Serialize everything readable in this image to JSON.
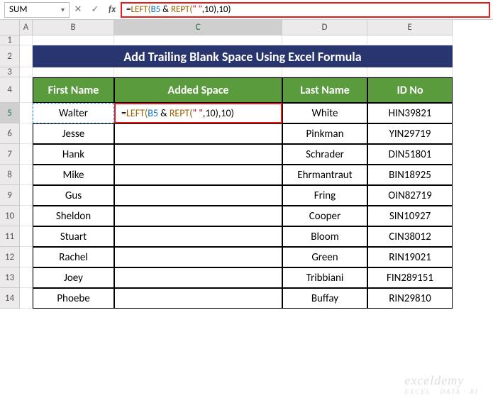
{
  "formula_bar": {
    "name_box": "SUM",
    "formula_prefix": "=",
    "fn1": "LEFT(",
    "ref": "B5",
    "amp": " & ",
    "fn2": "REPT(",
    "txt": "\" \"",
    "comma1": ",",
    "num1": "10",
    "close1": "),",
    "num2": "10",
    "close2": ")"
  },
  "title": "Add Trailing Blank Space Using Excel Formula",
  "headers": {
    "col_b": "First Name",
    "col_c": "Added Space",
    "col_d": "Last Name",
    "col_e": "ID No"
  },
  "columns": [
    "A",
    "B",
    "C",
    "D",
    "E"
  ],
  "rows": [
    "1",
    "2",
    "3",
    "4",
    "5",
    "6",
    "7",
    "8",
    "9",
    "10",
    "11",
    "12",
    "13",
    "14"
  ],
  "data": [
    {
      "first": "Walter",
      "added": "=LEFT(B5 & REPT(\" \",10),10)",
      "last": "White",
      "id": "HIN39821"
    },
    {
      "first": "Jesse",
      "added": "",
      "last": "Pinkman",
      "id": "YIN29719"
    },
    {
      "first": "Hank",
      "added": "",
      "last": "Schrader",
      "id": "DIN51801"
    },
    {
      "first": "Mike",
      "added": "",
      "last": "Ehrmantraut",
      "id": "BIN18925"
    },
    {
      "first": "Gus",
      "added": "",
      "last": "Fring",
      "id": "OIN82719"
    },
    {
      "first": "Sheldon",
      "added": "",
      "last": "Cooper",
      "id": "SIN10927"
    },
    {
      "first": "Stuart",
      "added": "",
      "last": "Bloom",
      "id": "CIN38012"
    },
    {
      "first": "Rachel",
      "added": "",
      "last": "Green",
      "id": "RIN19021"
    },
    {
      "first": "Joey",
      "added": "",
      "last": "Tribbiani",
      "id": "FIN289151"
    },
    {
      "first": "Phoebe",
      "added": "",
      "last": "Buffay",
      "id": "RIN29810"
    }
  ],
  "watermark": {
    "main": "exceldemy",
    "sub": "EXCEL · DATA · BI"
  },
  "chart_data": {
    "type": "table",
    "title": "Add Trailing Blank Space Using Excel Formula",
    "columns": [
      "First Name",
      "Added Space",
      "Last Name",
      "ID No"
    ],
    "rows": [
      [
        "Walter",
        "=LEFT(B5 & REPT(\" \",10),10)",
        "White",
        "HIN39821"
      ],
      [
        "Jesse",
        "",
        "Pinkman",
        "YIN29719"
      ],
      [
        "Hank",
        "",
        "Schrader",
        "DIN51801"
      ],
      [
        "Mike",
        "",
        "Ehrmantraut",
        "BIN18925"
      ],
      [
        "Gus",
        "",
        "Fring",
        "OIN82719"
      ],
      [
        "Sheldon",
        "",
        "Cooper",
        "SIN10927"
      ],
      [
        "Stuart",
        "",
        "Bloom",
        "CIN38012"
      ],
      [
        "Rachel",
        "",
        "Green",
        "RIN19021"
      ],
      [
        "Joey",
        "",
        "Tribbiani",
        "FIN289151"
      ],
      [
        "Phoebe",
        "",
        "Buffay",
        "RIN29810"
      ]
    ]
  }
}
